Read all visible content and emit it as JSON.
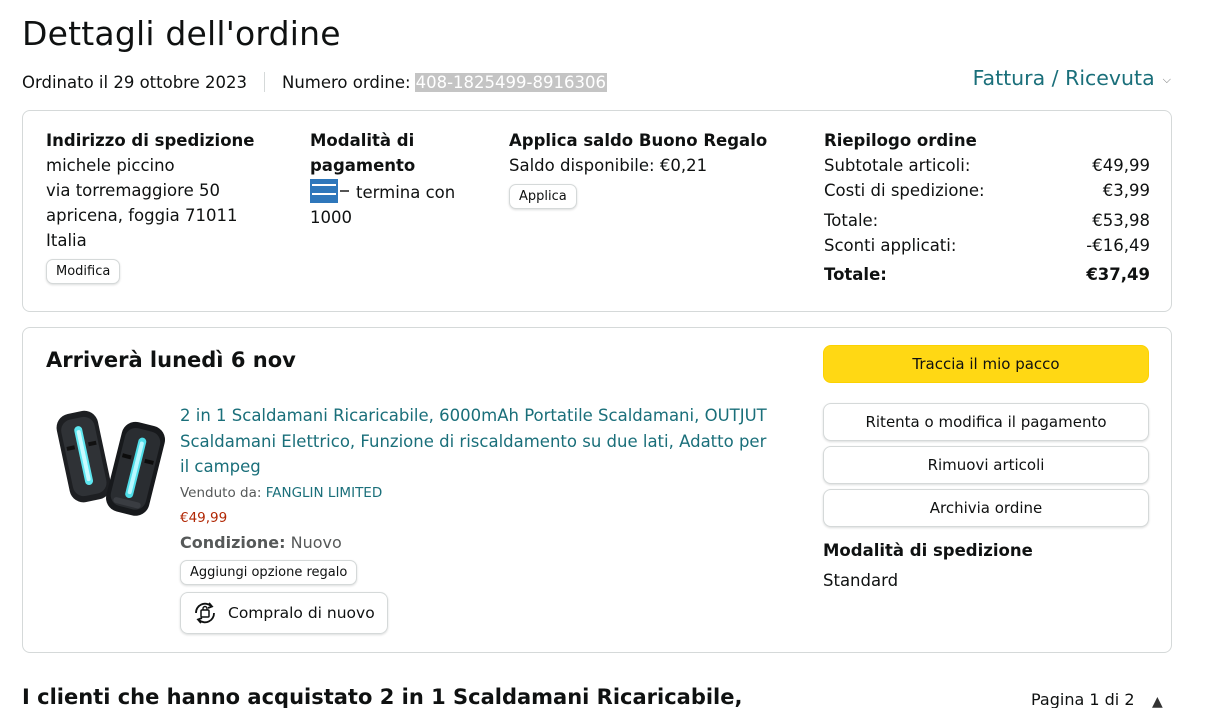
{
  "page": {
    "title": "Dettagli dell'ordine",
    "ordered_on": "Ordinato il 29 ottobre 2023",
    "order_number_label": "Numero ordine:",
    "order_number": "408-1825499-8916306",
    "invoice_link": "Fattura / Ricevuta",
    "invoice_icon": "chevron-down-icon"
  },
  "shipping_address": {
    "heading": "Indirizzo di spedizione",
    "name": "michele piccino",
    "street": "via torremaggiore 50",
    "city": "apricena, foggia 71011",
    "country": "Italia",
    "edit_button": "Modifica"
  },
  "payment": {
    "heading_line1": "Modalità di",
    "heading_line2": "pagamento",
    "card_icon": "american-express-card-icon",
    "ending_text": "termina con",
    "last_digits": "1000"
  },
  "gift_card": {
    "heading": "Applica saldo Buono Regalo",
    "balance": "Saldo disponibile: €0,21",
    "apply_button": "Applica"
  },
  "summary": {
    "heading": "Riepilogo ordine",
    "rows": [
      {
        "label": "Subtotale articoli:",
        "value": "€49,99"
      },
      {
        "label": "Costi di spedizione:",
        "value": "€3,99"
      },
      {
        "label": "Totale:",
        "value": "€53,98"
      },
      {
        "label": "Sconti applicati:",
        "value": "-€16,49"
      },
      {
        "label": "Totale:",
        "value": "€37,49"
      }
    ]
  },
  "shipment": {
    "arrival": "Arriverà lunedì 6 nov",
    "product_title": "2 in 1 Scaldamani Ricaricabile, 6000mAh Portatile Scaldamani, OUTJUT Scaldamani Elettrico, Funzione di riscaldamento su due lati, Adatto per il campeg",
    "sold_by_label": "Venduto da:",
    "seller": "FANGLIN LIMITED",
    "price": "€49,99",
    "condition_label": "Condizione:",
    "condition_value": "Nuovo",
    "gift_option_button": "Aggiungi opzione regalo",
    "buy_again_button": "Compralo di nuovo",
    "buy_again_icon": "rebuy-cycle-icon",
    "product_image": "hand-warmer-product-image",
    "actions": {
      "track": "Traccia il mio pacco",
      "retry_payment": "Ritenta o modifica il pagamento",
      "remove_items": "Rimuovi articoli",
      "archive": "Archivia ordine"
    },
    "shipping_method_heading": "Modalità di spedizione",
    "shipping_method": "Standard"
  },
  "recommendations": {
    "title": "I clienti che hanno acquistato 2 in 1 Scaldamani Ricaricabile,",
    "pager": "Pagina 1 di 2",
    "pager_icon": "chevron-up-icon"
  },
  "colors": {
    "link": "#1a6f7a",
    "price": "#b12704",
    "primary_button": "#ffd814",
    "border": "#d5d9d9",
    "card_blue": "#2e77bb"
  }
}
